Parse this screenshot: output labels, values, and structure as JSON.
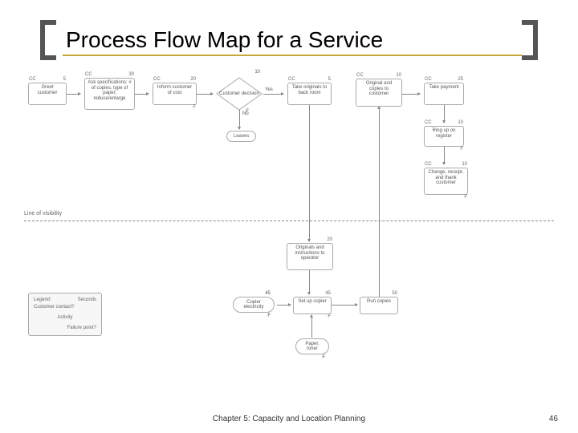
{
  "title": "Process Flow Map for a Service",
  "footer": "Chapter 5: Capacity and Location Planning",
  "page_number": "46",
  "line_of_visibility": "Line of visibility",
  "row1": {
    "greet": {
      "cc": "CC",
      "sec": "5",
      "text": "Greet customer"
    },
    "ask": {
      "cc": "CC",
      "sec": "30",
      "text": "Ask specifications: # of copies, type of paper, reduce/enlarge"
    },
    "inform": {
      "cc": "CC",
      "sec": "20",
      "text": "Inform customer of cost",
      "f": "F"
    },
    "decision": {
      "sec": "10",
      "text": "Customer decision",
      "f": "F",
      "yes": "Yes",
      "no": "No"
    },
    "take": {
      "cc": "CC",
      "sec": "5",
      "text": "Take originals to back room"
    },
    "orig": {
      "cc": "CC",
      "sec": "10",
      "text": "Original and copies to customer"
    },
    "pay": {
      "cc": "CC",
      "sec": "25",
      "text": "Take payment"
    }
  },
  "row2": {
    "ring": {
      "cc": "CC",
      "sec": "10",
      "text": "Ring up on register",
      "f": "F"
    },
    "change": {
      "cc": "CC",
      "sec": "10",
      "text": "Change, receipt, and thank customer",
      "f": "F"
    }
  },
  "leaves": "Leaves",
  "back": {
    "originals": {
      "sec": "20",
      "text": "Originals and instructions to operator"
    },
    "copier": {
      "sec": "45",
      "text": "Copier electricity",
      "f": "F"
    },
    "setup": {
      "sec": "45",
      "text": "Set up copier",
      "f": "F"
    },
    "run": {
      "sec": "50",
      "text": "Run copies"
    },
    "paper": {
      "text": "Paper, toner",
      "f": "F"
    }
  },
  "legend": {
    "title": "Legend:",
    "cc": "Customer contact?",
    "seconds": "Seconds",
    "activity": "Activity",
    "failure": "Failure point?"
  }
}
